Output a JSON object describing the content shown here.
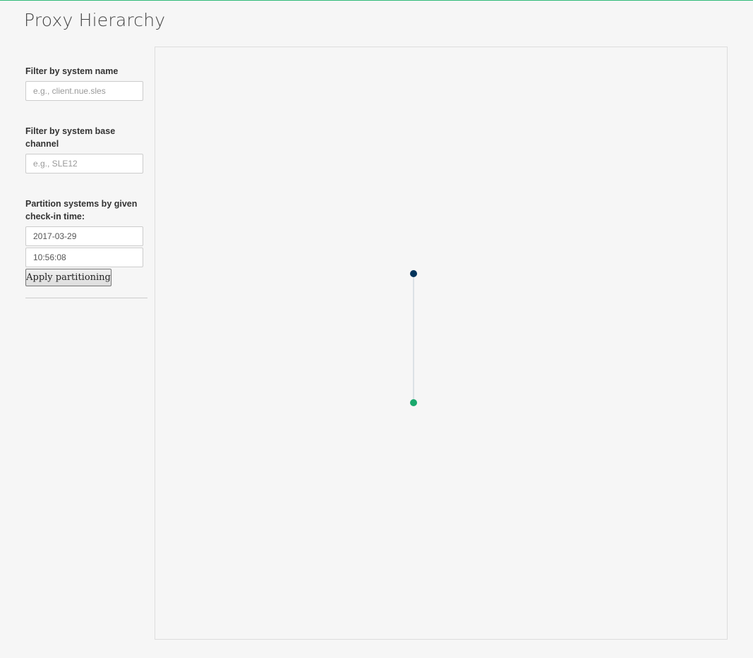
{
  "page": {
    "title": "Proxy Hierarchy",
    "accent_color": "#30ba78"
  },
  "filters": {
    "system_name": {
      "label": "Filter by system name",
      "placeholder": "e.g., client.nue.sles"
    },
    "base_channel": {
      "label": "Filter by system base channel",
      "placeholder": "e.g., SLE12"
    },
    "partition": {
      "label": "Partition systems by given check-in time:",
      "date_value": "2017-03-29",
      "time_value": "10:56:08",
      "apply_label": "Apply partitioning"
    }
  },
  "graph": {
    "nodes": [
      {
        "role": "root",
        "color": "#00335a"
      },
      {
        "role": "child",
        "color": "#1aa86c"
      }
    ],
    "edge_color": "#c2ccd6"
  }
}
